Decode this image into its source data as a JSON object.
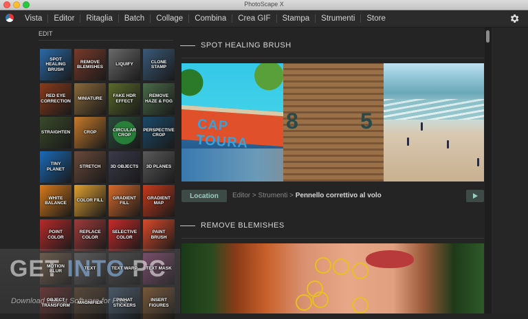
{
  "window": {
    "title": "PhotoScape X"
  },
  "menu": [
    "Vista",
    "Editor",
    "Ritaglia",
    "Batch",
    "Collage",
    "Combina",
    "Crea GIF",
    "Stampa",
    "Strumenti",
    "Store"
  ],
  "left": {
    "label": "EDIT",
    "tiles": [
      {
        "label": "Spot Healing Brush",
        "bg": "#2a6aa8"
      },
      {
        "label": "Remove Blemishes",
        "bg": "#7a3a2a"
      },
      {
        "label": "Liquify",
        "bg": "#6a6a6a"
      },
      {
        "label": "Clone Stamp",
        "bg": "#3a5a7a"
      },
      {
        "label": "Red Eye Correction",
        "bg": "#8a3a1a"
      },
      {
        "label": "Miniature",
        "bg": "#8a6a3a"
      },
      {
        "label": "Fake HDR Effect",
        "bg": "#5a6a2a"
      },
      {
        "label": "Remove Haze & Fog",
        "bg": "#4a6a4a"
      },
      {
        "label": "Straighten",
        "bg": "#3a4a2a"
      },
      {
        "label": "Crop",
        "bg": "#c87a2a"
      },
      {
        "label": "Circular Crop",
        "bg": "#2a4a3a",
        "circle": true
      },
      {
        "label": "Perspective Crop",
        "bg": "#1a4a6a"
      },
      {
        "label": "Tiny Planet",
        "bg": "#1a6ab8"
      },
      {
        "label": "Stretch",
        "bg": "#6a4a3a"
      },
      {
        "label": "3D Objects",
        "bg": "#3a3a4a"
      },
      {
        "label": "3D Planes",
        "bg": "#5a5a5a"
      },
      {
        "label": "White Balance",
        "bg": "#d87a1a"
      },
      {
        "label": "Color Fill",
        "bg": "#e0a030"
      },
      {
        "label": "Gradient Fill",
        "bg": "#d86a2a"
      },
      {
        "label": "Gradient Map",
        "bg": "#c83a1a"
      },
      {
        "label": "Point Color",
        "bg": "#b82a2a"
      },
      {
        "label": "Replace Color",
        "bg": "#a03a3a"
      },
      {
        "label": "Selective Color",
        "bg": "#c82a2a"
      },
      {
        "label": "Paint Brush",
        "bg": "#d84a2a"
      },
      {
        "label": "Motion Blur",
        "bg": "#5a4a3a"
      },
      {
        "label": "Text",
        "bg": "#4a4a4a"
      },
      {
        "label": "Text Warp",
        "bg": "#3a3a3a"
      },
      {
        "label": "Text Mask",
        "bg": "#6a3a5a"
      },
      {
        "label": "Object Transform",
        "bg": "#5a2a2a"
      },
      {
        "label": "Magnifier",
        "bg": "#4a3a2a"
      },
      {
        "label": "Pinhat Stickers",
        "bg": "#3a4a5a"
      },
      {
        "label": "Insert Figures",
        "bg": "#6a4a2a"
      }
    ]
  },
  "watermark": {
    "main_a": "GET ",
    "main_b": "INTO",
    "main_c": " PC",
    "sub": "Download Latest Software for Free"
  },
  "sections": {
    "spot_title": "SPOT HEALING BRUSH",
    "blem_title": "REMOVE BLEMISHES",
    "photo1_text": "CAP TOURA",
    "photo2_nums": [
      "8",
      "5"
    ]
  },
  "location": {
    "button": "Location",
    "crumb_prefix": "Editor > Strumenti > ",
    "crumb_current": "Pennello correttivo al volo"
  },
  "colors": {
    "accent": "#9ad0c0",
    "bg": "#242424"
  }
}
